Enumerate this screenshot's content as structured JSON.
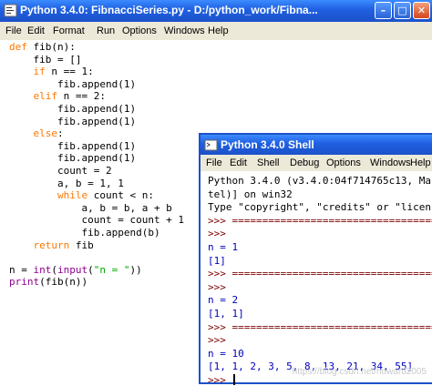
{
  "editor": {
    "title": "Python 3.4.0: FibnacciSeries.py - D:/python_work/Fibna...",
    "menu": [
      "File",
      "Edit",
      "Format",
      "Run",
      "Options",
      "Windows",
      "Help"
    ],
    "code": [
      "def fib(n):",
      "    fib = []",
      "    if n == 1:",
      "        fib.append(1)",
      "    elif n == 2:",
      "        fib.append(1)",
      "        fib.append(1)",
      "    else:",
      "        fib.append(1)",
      "        fib.append(1)",
      "        count = 2",
      "        a, b = 1, 1",
      "        while count < n:",
      "            a, b = b, a + b",
      "            count = count + 1",
      "            fib.append(b)",
      "    return fib",
      "",
      "n = int(input(\"n = \"))",
      "print(fib(n))"
    ]
  },
  "shell": {
    "title": "Python 3.4.0 Shell",
    "menu": [
      "File",
      "Edit",
      "Shell",
      "Debug",
      "Options",
      "Windows",
      "Help"
    ],
    "lines": [
      "Python 3.4.0 (v3.4.0:04f714765c13, Ma",
      "tel)] on win32",
      "Type \"copyright\", \"credits\" or \"licen",
      ">>> ==================================",
      ">>>",
      "n = 1",
      "[1]",
      ">>> ==================================",
      ">>>",
      "n = 2",
      "[1, 1]",
      ">>> ==================================",
      ">>>",
      "n = 10",
      "[1, 1, 2, 3, 5, 8, 13, 21, 34, 55]",
      ">>> "
    ]
  },
  "watermark": "https://blog.csdn.net/howard2005"
}
